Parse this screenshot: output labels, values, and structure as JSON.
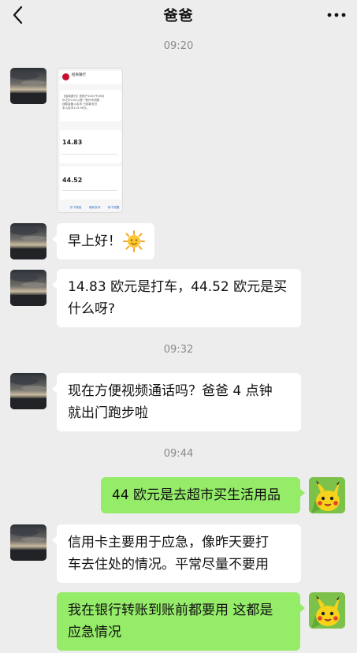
{
  "header": {
    "title": "爸爸",
    "back_icon": "chevron-left-icon",
    "more_icon": "ellipsis-icon"
  },
  "messages": {
    "time1": "09:20",
    "screenshot": {
      "bank_name": "招商银行",
      "text_line1": "【招商银行】您账户4455于08月",
      "text_line2": "04日20:54入账一笔外币消费",
      "text_line3": "钱款金额人民币 已扣款支付",
      "text_line4": "本人民币119.96元。",
      "amount1": "14.83",
      "amount2": "44.52",
      "bottom_link1": "折卡额度",
      "bottom_link2": "最新查询",
      "bottom_link3": "刷卡提醒"
    },
    "msg1": "早上好！",
    "msg1_emoji": "sun-face-icon",
    "msg2_line1": "14.83 欧元是打车，44.52 欧元是买",
    "msg2_line2": "什么呀?",
    "time2": "09:32",
    "msg3_line1": "现在方便视频通话吗？爸爸 4 点钟",
    "msg3_line2": "就出门跑步啦",
    "time3": "09:44",
    "msg4": "44 欧元是去超市买生活用品",
    "msg5_line1": "信用卡主要用于应急，像昨天要打",
    "msg5_line2": "车去住处的情况。平常尽量不要用",
    "msg6_line1": "我在银行转账到账前都要用 这都是",
    "msg6_line2": "应急情况"
  },
  "colors": {
    "background": "#ededed",
    "incoming_bubble": "#ffffff",
    "outgoing_bubble": "#95ec69",
    "timestamp": "#8a8a8a"
  }
}
